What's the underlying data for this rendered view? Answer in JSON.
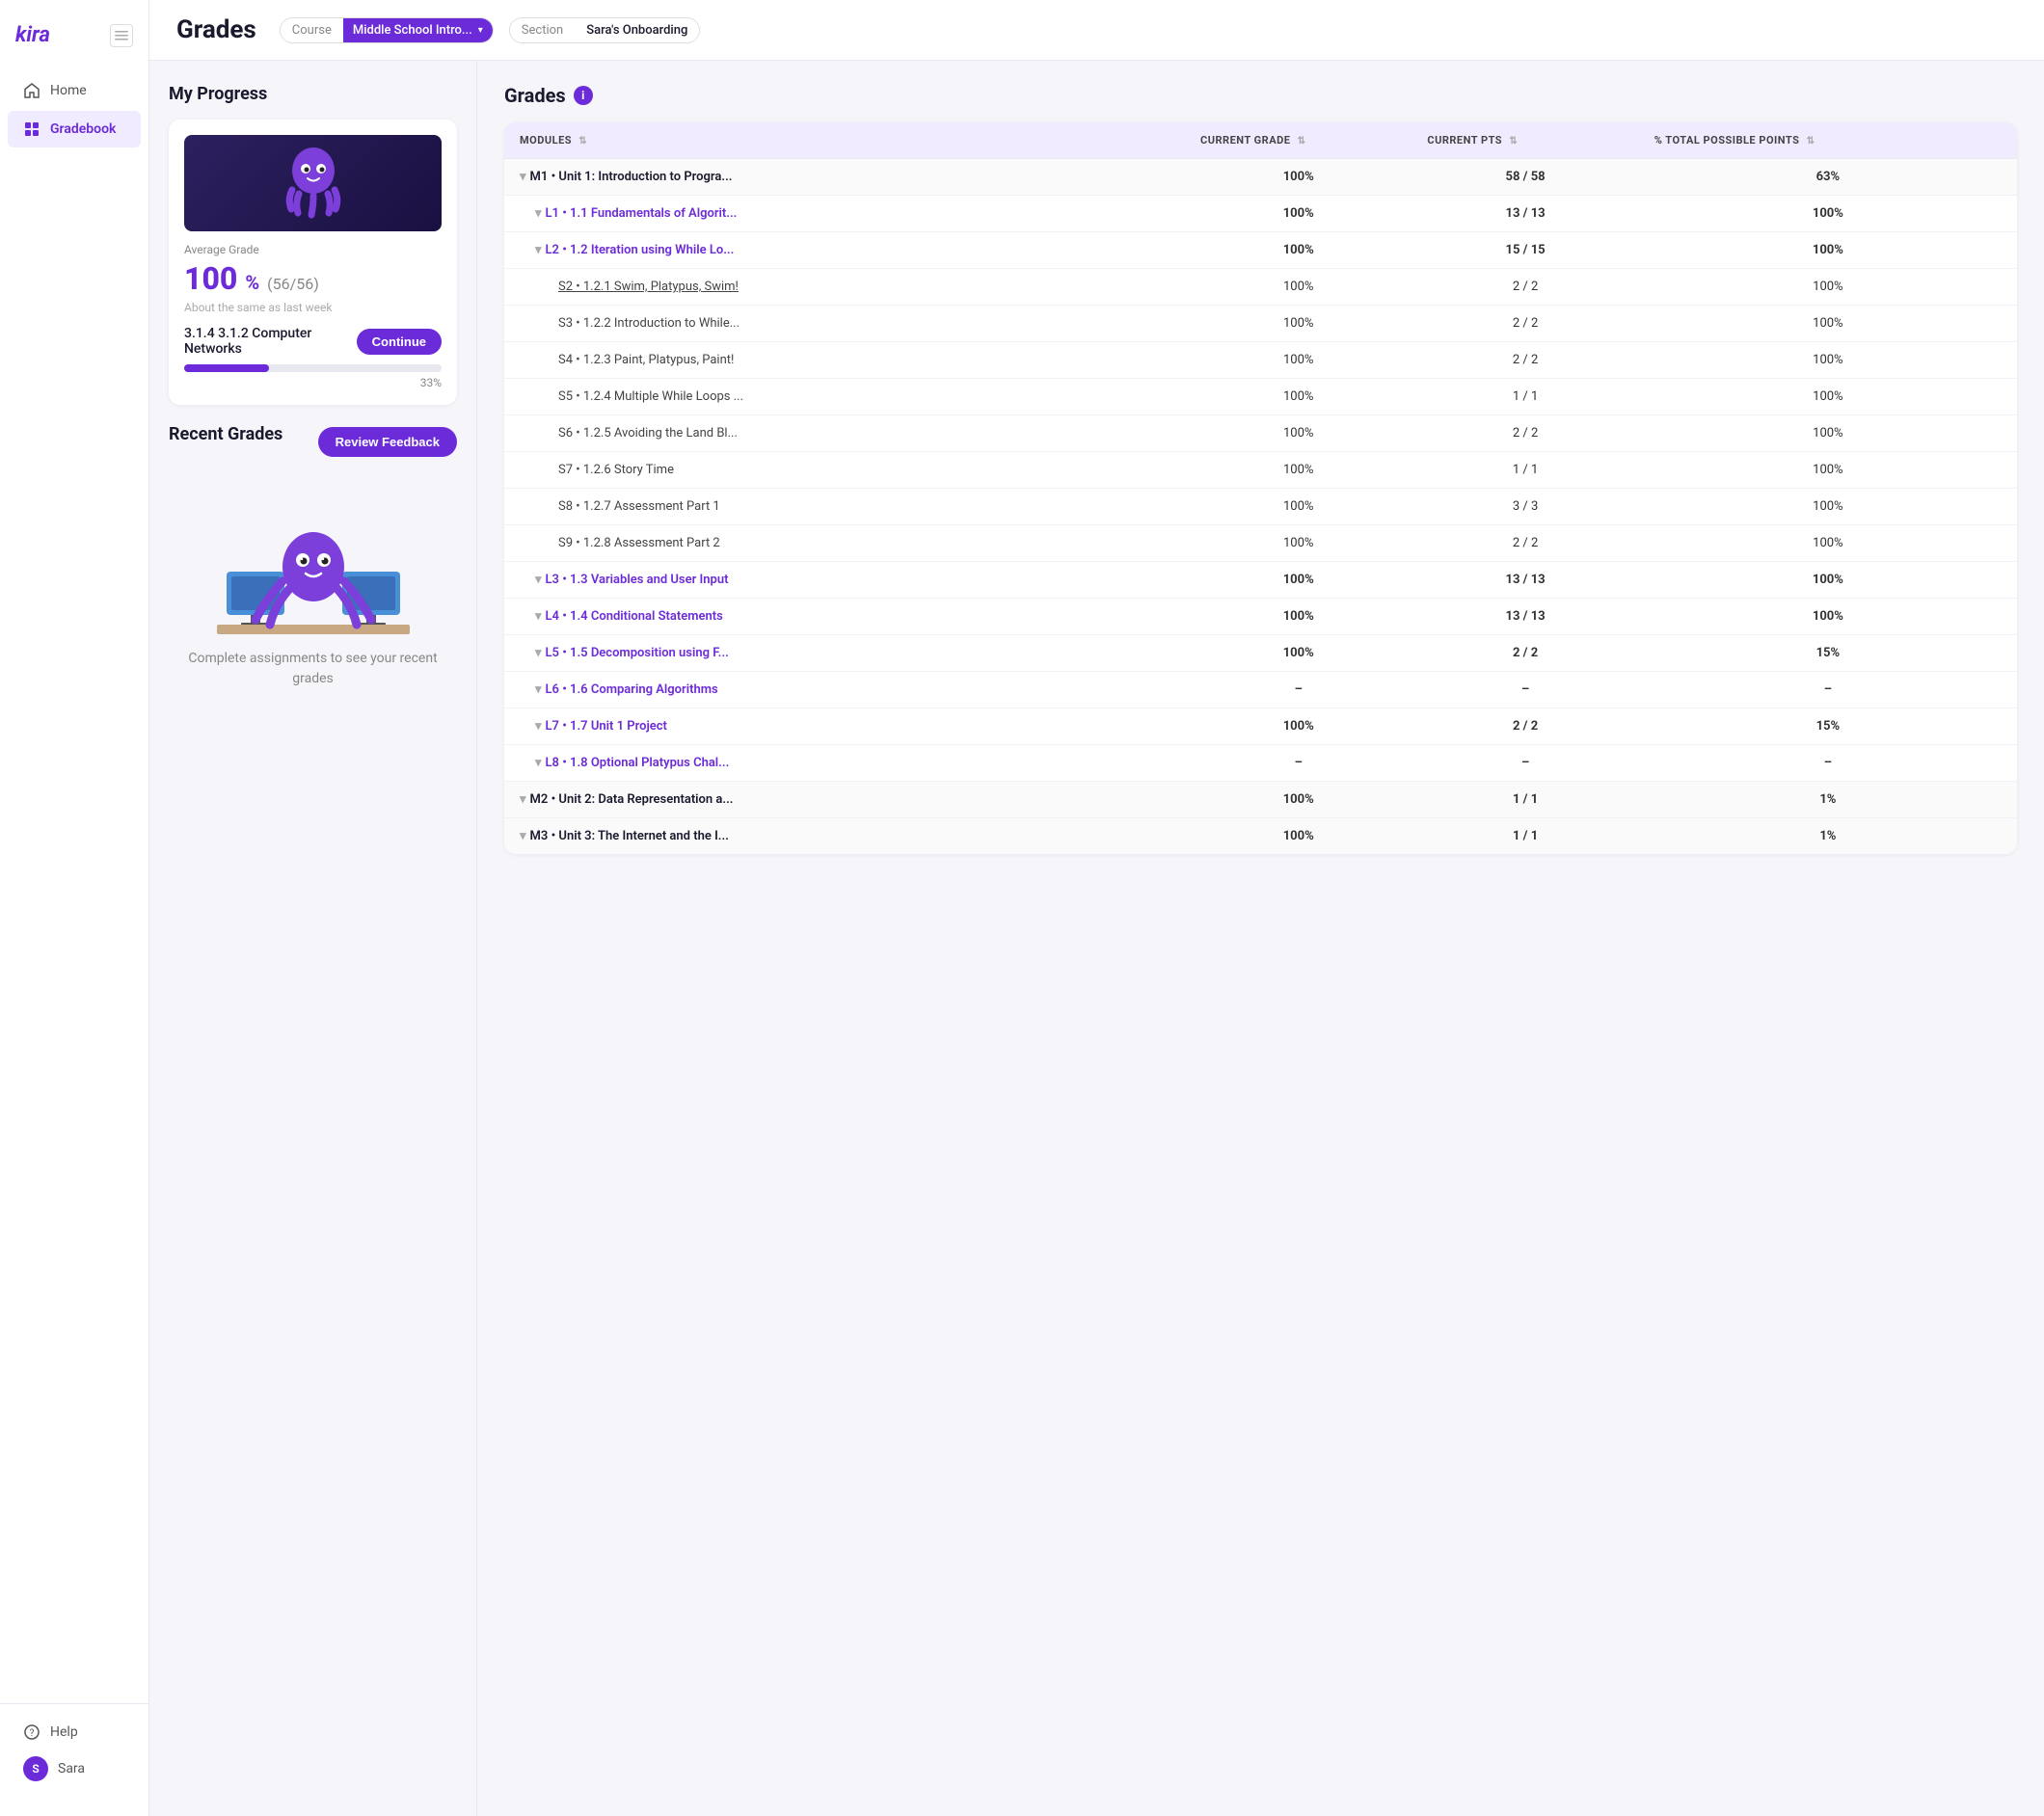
{
  "app": {
    "name": "kira",
    "logo": "kira"
  },
  "sidebar": {
    "nav_items": [
      {
        "id": "home",
        "label": "Home",
        "icon": "home-icon",
        "active": false
      },
      {
        "id": "gradebook",
        "label": "Gradebook",
        "icon": "grid-icon",
        "active": true
      }
    ],
    "footer_items": [
      {
        "id": "help",
        "label": "Help",
        "icon": "help-icon"
      },
      {
        "id": "user",
        "label": "Sara",
        "icon": "avatar-icon",
        "initials": "S"
      }
    ]
  },
  "header": {
    "title": "Grades",
    "course_label": "Course",
    "course_value": "Middle School Intro...",
    "section_label": "Section",
    "section_value": "Sara's Onboarding"
  },
  "left_panel": {
    "my_progress_title": "My Progress",
    "average_grade_label": "Average Grade",
    "average_value": "100",
    "average_pct_symbol": "%",
    "average_fraction": "(56/56)",
    "average_note": "About the same as last week",
    "continue_label": "3.1.4 3.1.2 Computer Networks",
    "continue_btn": "Continue",
    "progress_pct": "33%",
    "recent_grades_title": "Recent Grades",
    "review_feedback_btn": "Review Feedback",
    "empty_state_text": "Complete assignments to see your recent grades"
  },
  "grades": {
    "title": "Grades",
    "columns": {
      "modules": "MODULES",
      "current_grade": "CURRENT GRADE",
      "current_pts": "CURRENT PTS",
      "pct_total": "% TOTAL POSSIBLE POINTS"
    },
    "rows": [
      {
        "type": "unit",
        "indent": 0,
        "expand": true,
        "collapsed": false,
        "name": "M1 • Unit 1: Introduction to Progra...",
        "grade": "100%",
        "pts": "58 / 58",
        "pct": "63%"
      },
      {
        "type": "lesson",
        "indent": 1,
        "expand": true,
        "collapsed": false,
        "name": "L1 • 1.1 Fundamentals of Algorit...",
        "grade": "100%",
        "pts": "13 / 13",
        "pct": "100%"
      },
      {
        "type": "lesson",
        "indent": 1,
        "expand": true,
        "collapsed": false,
        "name": "L2 • 1.2 Iteration using While Lo...",
        "grade": "100%",
        "pts": "15 / 15",
        "pct": "100%"
      },
      {
        "type": "section",
        "indent": 2,
        "expand": false,
        "collapsed": false,
        "name": "S2 • 1.2.1 Swim, Platypus, Swim!",
        "grade": "100%",
        "pts": "2 / 2",
        "pct": "100%",
        "link": true
      },
      {
        "type": "section",
        "indent": 2,
        "expand": false,
        "collapsed": false,
        "name": "S3 • 1.2.2 Introduction to While...",
        "grade": "100%",
        "pts": "2 / 2",
        "pct": "100%"
      },
      {
        "type": "section",
        "indent": 2,
        "expand": false,
        "collapsed": false,
        "name": "S4 • 1.2.3 Paint, Platypus, Paint!",
        "grade": "100%",
        "pts": "2 / 2",
        "pct": "100%"
      },
      {
        "type": "section",
        "indent": 2,
        "expand": false,
        "collapsed": false,
        "name": "S5 • 1.2.4 Multiple While Loops ...",
        "grade": "100%",
        "pts": "1 / 1",
        "pct": "100%"
      },
      {
        "type": "section",
        "indent": 2,
        "expand": false,
        "collapsed": false,
        "name": "S6 • 1.2.5 Avoiding the Land Bl...",
        "grade": "100%",
        "pts": "2 / 2",
        "pct": "100%"
      },
      {
        "type": "section",
        "indent": 2,
        "expand": false,
        "collapsed": false,
        "name": "S7 • 1.2.6 Story Time",
        "grade": "100%",
        "pts": "1 / 1",
        "pct": "100%"
      },
      {
        "type": "section",
        "indent": 2,
        "expand": false,
        "collapsed": false,
        "name": "S8 • 1.2.7 Assessment Part 1",
        "grade": "100%",
        "pts": "3 / 3",
        "pct": "100%"
      },
      {
        "type": "section",
        "indent": 2,
        "expand": false,
        "collapsed": false,
        "name": "S9 • 1.2.8 Assessment Part 2",
        "grade": "100%",
        "pts": "2 / 2",
        "pct": "100%"
      },
      {
        "type": "lesson",
        "indent": 1,
        "expand": true,
        "collapsed": false,
        "name": "L3 • 1.3 Variables and User Input",
        "grade": "100%",
        "pts": "13 / 13",
        "pct": "100%"
      },
      {
        "type": "lesson",
        "indent": 1,
        "expand": true,
        "collapsed": false,
        "name": "L4 • 1.4 Conditional Statements",
        "grade": "100%",
        "pts": "13 / 13",
        "pct": "100%"
      },
      {
        "type": "lesson",
        "indent": 1,
        "expand": true,
        "collapsed": false,
        "name": "L5 • 1.5 Decomposition using F...",
        "grade": "100%",
        "pts": "2 / 2",
        "pct": "15%"
      },
      {
        "type": "lesson",
        "indent": 1,
        "expand": true,
        "collapsed": false,
        "name": "L6 • 1.6 Comparing Algorithms",
        "grade": "–",
        "pts": "–",
        "pct": "–"
      },
      {
        "type": "lesson",
        "indent": 1,
        "expand": true,
        "collapsed": false,
        "name": "L7 • 1.7 Unit 1 Project",
        "grade": "100%",
        "pts": "2 / 2",
        "pct": "15%"
      },
      {
        "type": "lesson",
        "indent": 1,
        "expand": true,
        "collapsed": false,
        "name": "L8 • 1.8 Optional Platypus Chal...",
        "grade": "–",
        "pts": "–",
        "pct": "–"
      },
      {
        "type": "unit",
        "indent": 0,
        "expand": true,
        "collapsed": false,
        "name": "M2 • Unit 2: Data Representation a...",
        "grade": "100%",
        "pts": "1 / 1",
        "pct": "1%"
      },
      {
        "type": "unit",
        "indent": 0,
        "expand": true,
        "collapsed": false,
        "name": "M3 • Unit 3: The Internet and the I...",
        "grade": "100%",
        "pts": "1 / 1",
        "pct": "1%"
      }
    ]
  },
  "colors": {
    "brand": "#6c2bd9",
    "brand_light": "#f0ebff",
    "text_dark": "#1a1a2e",
    "text_muted": "#888"
  }
}
